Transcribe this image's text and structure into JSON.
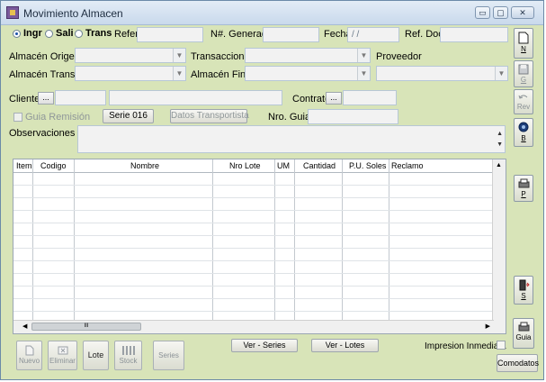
{
  "window": {
    "title": "Movimiento Almacen",
    "minimize": "▭",
    "maximize": "▢",
    "close": "✕"
  },
  "movement_type": {
    "options": [
      {
        "label": "Ingr",
        "selected": true
      },
      {
        "label": "Sali",
        "selected": false
      },
      {
        "label": "Trans",
        "selected": false
      }
    ]
  },
  "header": {
    "refer_label": "Refer:",
    "generado_label": "N#. Generado",
    "fecha_label": "Fecha",
    "fecha_value": "/ /",
    "refdoc_label": "Ref. Doc",
    "almacen_origen_label": "Almacén Origen",
    "transaccion_label": "Transaccion",
    "proveedor_label": "Proveedor",
    "almacen_transf_label": "Almacén Transf.",
    "almacen_final_label": "Almacén Final",
    "cliente_label": "Cliente:",
    "contrato_label": "Contrato",
    "ellipsis": "...",
    "guia_remision_label": "Guia Remisión",
    "serie_button": "Serie 016",
    "datos_transportista_button": "Datos Transportista",
    "nro_guia_label": "Nro. Guia",
    "observaciones_label": "Observaciones"
  },
  "grid": {
    "columns": [
      "Item",
      "Codigo",
      "Nombre",
      "Nro Lote",
      "UM",
      "Cantidad",
      "P.U. Soles",
      "Reclamo"
    ],
    "hscroll_grip": "III",
    "arrow_up": "▲",
    "arrow_down": "▼",
    "arrow_left": "◀",
    "arrow_right": "▶"
  },
  "toolbar": {
    "nuevo": "N",
    "grabar": "G",
    "rev": "Rev",
    "buscar": "B",
    "imprimir": "P",
    "salir": "S",
    "guia": "Guia"
  },
  "bottom": {
    "nuevo": "Nuevo",
    "eliminar": "Eliminar",
    "lote": "Lote",
    "stock": "Stock",
    "series": "Series",
    "ver_series": "Ver - Series",
    "ver_lotes": "Ver - Lotes",
    "impresion_inmediata": "Impresion Inmediata",
    "comodatos": "Comodatos"
  },
  "colors": {
    "form_bg": "#d8e4b8",
    "title_bg": "#c9d9ec",
    "field_bg": "#f2f2f2"
  }
}
